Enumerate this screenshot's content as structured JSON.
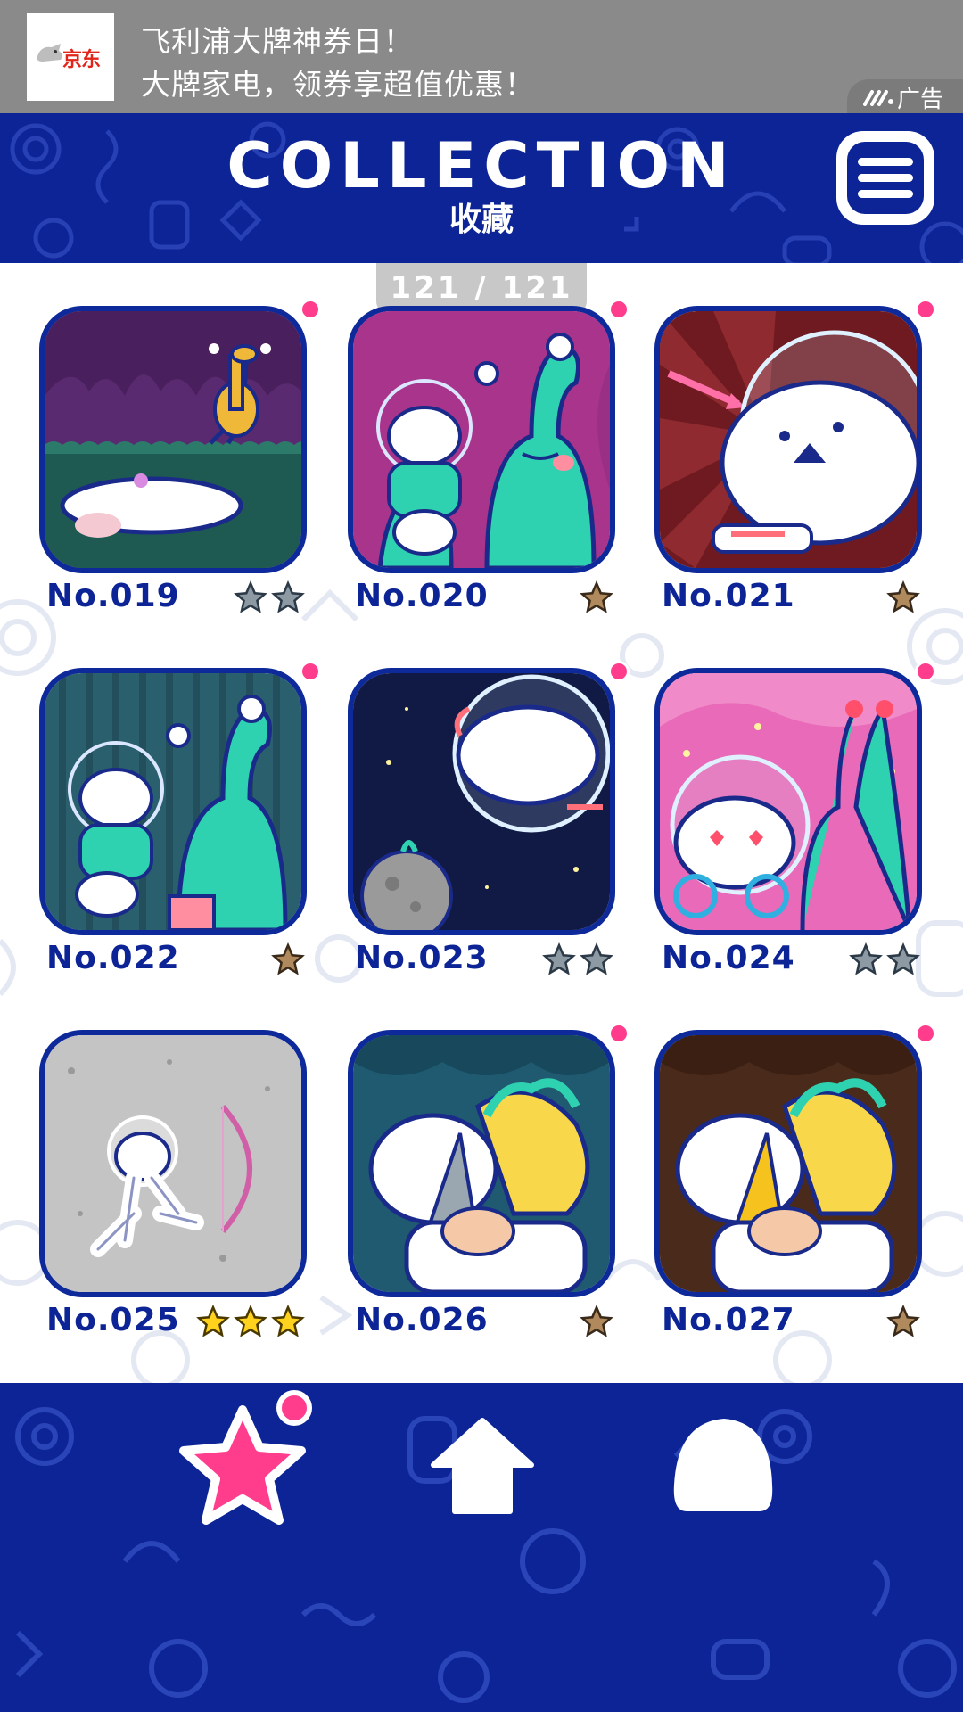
{
  "ad": {
    "logo_text": "京东",
    "line1": "飞利浦大牌神券日！",
    "line2": "大牌家电，领券享超值优惠！",
    "tag": "广告"
  },
  "header": {
    "title": "COLLECTION",
    "subtitle": "收藏",
    "menu_icon": "hamburger-menu-icon"
  },
  "page_counter": "121 / 121",
  "items": [
    {
      "label": "No.019",
      "stars": 2,
      "star_color": "gray"
    },
    {
      "label": "No.020",
      "stars": 1,
      "star_color": "bronze"
    },
    {
      "label": "No.021",
      "stars": 1,
      "star_color": "bronze"
    },
    {
      "label": "No.022",
      "stars": 1,
      "star_color": "bronze"
    },
    {
      "label": "No.023",
      "stars": 2,
      "star_color": "gray"
    },
    {
      "label": "No.024",
      "stars": 2,
      "star_color": "gray"
    },
    {
      "label": "No.025",
      "stars": 3,
      "star_color": "gold"
    },
    {
      "label": "No.026",
      "stars": 1,
      "star_color": "bronze"
    },
    {
      "label": "No.027",
      "stars": 1,
      "star_color": "bronze"
    }
  ],
  "nav": {
    "items": [
      {
        "icon": "star-icon",
        "active": true
      },
      {
        "icon": "home-icon",
        "active": false
      },
      {
        "icon": "character-icon",
        "active": false
      }
    ]
  },
  "colors": {
    "navy": "#0c2496",
    "pink": "#ff3d8c",
    "star_gold": "#ffd21e",
    "star_bronze": "#b08a5c",
    "star_gray": "#8d9aa3"
  }
}
